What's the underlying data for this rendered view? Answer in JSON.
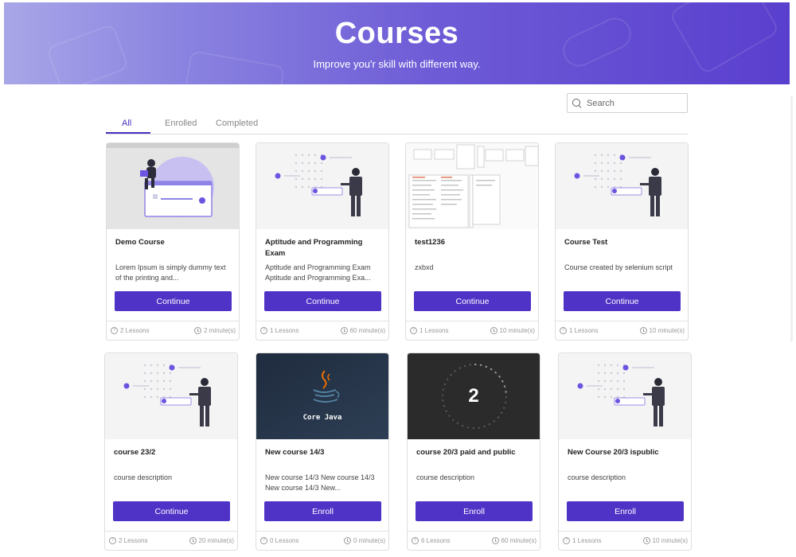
{
  "hero": {
    "title": "Courses",
    "subtitle": "Improve you'r skill with different way."
  },
  "search": {
    "placeholder": "Search",
    "value": ""
  },
  "tabs": [
    {
      "label": "All",
      "active": true
    },
    {
      "label": "Enrolled",
      "active": false
    },
    {
      "label": "Completed",
      "active": false
    }
  ],
  "colors": {
    "accent": "#4f33c6",
    "hero_start": "#a9a6e8",
    "hero_end": "#5a3fce"
  },
  "courses": [
    {
      "title": "Demo Course",
      "desc": "Lorem Ipsum is simply dummy text of the printing and...",
      "button": "Continue",
      "lessons": "2 Lessons",
      "duration": "2 minute(s)",
      "thumb": "learner-illustration"
    },
    {
      "title": "Aptitude and Programming Exam",
      "desc": "Aptitude and Programming Exam Aptitude and Programming Exa...",
      "button": "Continue",
      "lessons": "1 Lessons",
      "duration": "60 minute(s)",
      "thumb": "presenter-illustration"
    },
    {
      "title": "test1236",
      "desc": "zxbxd",
      "button": "Continue",
      "lessons": "1 Lessons",
      "duration": "10 minute(s)",
      "thumb": "document-screenshot"
    },
    {
      "title": "Course Test",
      "desc": "Course created by selenium script",
      "button": "Continue",
      "lessons": "1 Lessons",
      "duration": "10 minute(s)",
      "thumb": "presenter-illustration"
    },
    {
      "title": "course 23/2",
      "desc": "course description",
      "button": "Continue",
      "lessons": "2 Lessons",
      "duration": "20 minute(s)",
      "thumb": "presenter-illustration"
    },
    {
      "title": "New course 14/3",
      "desc": "New course 14/3 New course 14/3 New course 14/3 New...",
      "button": "Enroll",
      "lessons": "0 Lessons",
      "duration": "0 minute(s)",
      "thumb": "core-java",
      "thumb_text": "Core Java"
    },
    {
      "title": "course 20/3 paid and public",
      "desc": "course description",
      "button": "Enroll",
      "lessons": "6 Lessons",
      "duration": "60 minute(s)",
      "thumb": "countdown",
      "thumb_text": "2"
    },
    {
      "title": "New Course 20/3 ispublic",
      "desc": "course description",
      "button": "Enroll",
      "lessons": "1 Lessons",
      "duration": "10 minute(s)",
      "thumb": "presenter-illustration"
    }
  ]
}
